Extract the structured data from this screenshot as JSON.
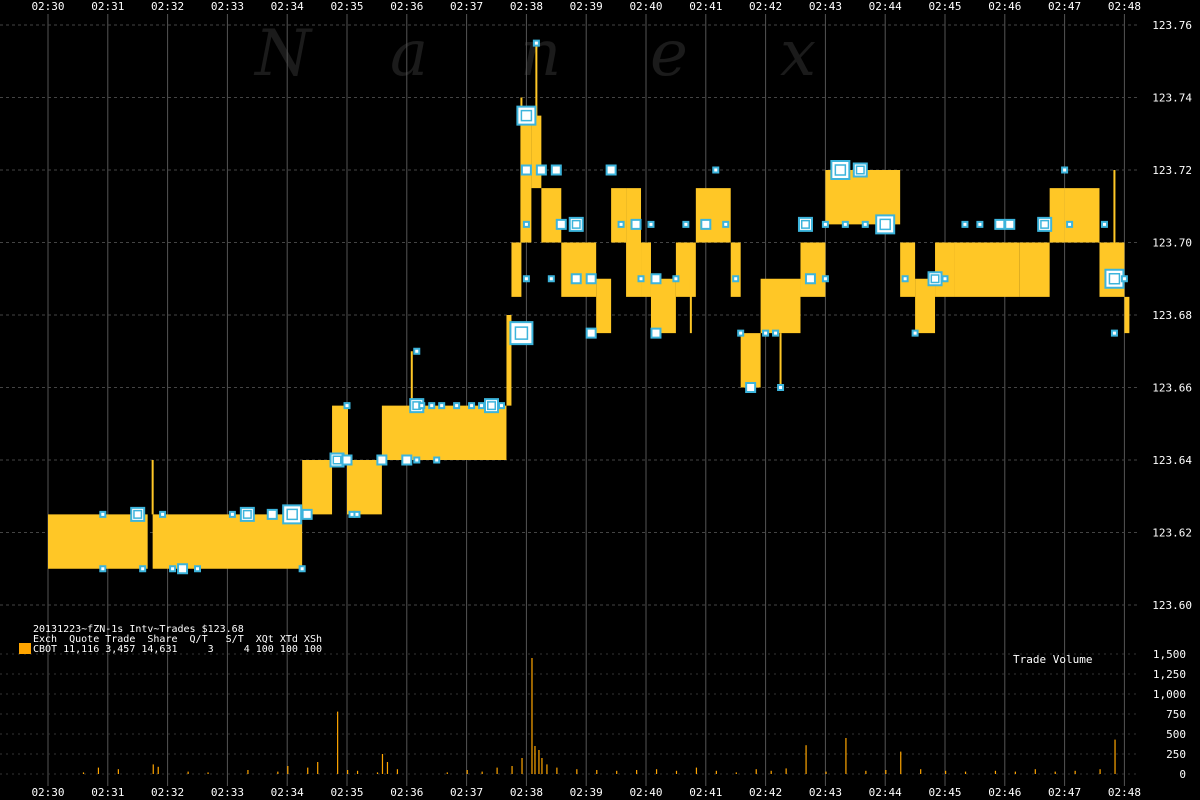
{
  "watermark": [
    "N",
    "a",
    "n",
    "e",
    "x"
  ],
  "info": {
    "title": "20131223~fZN-1s Intv~Trades $123.68",
    "header": "Exch  Quote Trade  Share  Q/T   S/T  XQt XTd XSh",
    "row": "CBOT 11,116 3,457 14,631     3     4 100 100 100",
    "swatch_color": "#FFA500"
  },
  "chart_data": [
    {
      "type": "area",
      "title": "",
      "x_ticks": [
        "02:30",
        "02:31",
        "02:32",
        "02:33",
        "02:34",
        "02:35",
        "02:36",
        "02:37",
        "02:38",
        "02:39",
        "02:40",
        "02:41",
        "02:42",
        "02:43",
        "02:44",
        "02:45",
        "02:46",
        "02:47",
        "02:48"
      ],
      "y_ticks": [
        "123.60",
        "123.62",
        "123.64",
        "123.66",
        "123.68",
        "123.70",
        "123.72",
        "123.74",
        "123.76"
      ],
      "ylim": [
        123.6,
        123.76
      ],
      "grid": true,
      "band_color": "#FFC726",
      "quote_marker_color": "#3CB4DC",
      "bid_ask_band": [
        {
          "t_start": "02:30:00",
          "t_end": "02:31:40",
          "low": 123.61,
          "high": 123.625
        },
        {
          "t_start": "02:31:45",
          "t_end": "02:34:15",
          "low": 123.61,
          "high": 123.625
        },
        {
          "t_start": "02:34:15",
          "t_end": "02:34:45",
          "low": 123.625,
          "high": 123.64
        },
        {
          "t_start": "02:34:45",
          "t_end": "02:35:00",
          "low": 123.64,
          "high": 123.655
        },
        {
          "t_start": "02:35:00",
          "t_end": "02:35:35",
          "low": 123.625,
          "high": 123.64
        },
        {
          "t_start": "02:35:35",
          "t_end": "02:37:40",
          "low": 123.64,
          "high": 123.655
        },
        {
          "t_start": "02:37:40",
          "t_end": "02:37:45",
          "low": 123.655,
          "high": 123.68
        },
        {
          "t_start": "02:37:45",
          "t_end": "02:37:55",
          "low": 123.685,
          "high": 123.7
        },
        {
          "t_start": "02:37:55",
          "t_end": "02:38:05",
          "low": 123.7,
          "high": 123.735
        },
        {
          "t_start": "02:38:05",
          "t_end": "02:38:15",
          "low": 123.715,
          "high": 123.735
        },
        {
          "t_start": "02:38:15",
          "t_end": "02:38:35",
          "low": 123.7,
          "high": 123.715
        },
        {
          "t_start": "02:38:35",
          "t_end": "02:39:10",
          "low": 123.685,
          "high": 123.7
        },
        {
          "t_start": "02:39:10",
          "t_end": "02:39:25",
          "low": 123.675,
          "high": 123.69
        },
        {
          "t_start": "02:39:25",
          "t_end": "02:39:40",
          "low": 123.7,
          "high": 123.715
        },
        {
          "t_start": "02:39:40",
          "t_end": "02:39:55",
          "low": 123.685,
          "high": 123.715
        },
        {
          "t_start": "02:39:55",
          "t_end": "02:40:05",
          "low": 123.685,
          "high": 123.7
        },
        {
          "t_start": "02:40:05",
          "t_end": "02:40:30",
          "low": 123.675,
          "high": 123.69
        },
        {
          "t_start": "02:40:30",
          "t_end": "02:40:50",
          "low": 123.685,
          "high": 123.7
        },
        {
          "t_start": "02:40:50",
          "t_end": "02:41:25",
          "low": 123.7,
          "high": 123.715
        },
        {
          "t_start": "02:41:25",
          "t_end": "02:41:35",
          "low": 123.685,
          "high": 123.7
        },
        {
          "t_start": "02:41:35",
          "t_end": "02:41:55",
          "low": 123.66,
          "high": 123.675
        },
        {
          "t_start": "02:41:55",
          "t_end": "02:42:35",
          "low": 123.675,
          "high": 123.69
        },
        {
          "t_start": "02:42:35",
          "t_end": "02:43:00",
          "low": 123.685,
          "high": 123.7
        },
        {
          "t_start": "02:43:00",
          "t_end": "02:44:15",
          "low": 123.705,
          "high": 123.72
        },
        {
          "t_start": "02:44:15",
          "t_end": "02:44:30",
          "low": 123.685,
          "high": 123.7
        },
        {
          "t_start": "02:44:30",
          "t_end": "02:44:50",
          "low": 123.675,
          "high": 123.69
        },
        {
          "t_start": "02:44:50",
          "t_end": "02:45:10",
          "low": 123.685,
          "high": 123.7
        },
        {
          "t_start": "02:45:10",
          "t_end": "02:46:15",
          "low": 123.685,
          "high": 123.7
        },
        {
          "t_start": "02:46:15",
          "t_end": "02:46:45",
          "low": 123.685,
          "high": 123.7
        },
        {
          "t_start": "02:46:45",
          "t_end": "02:47:00",
          "low": 123.7,
          "high": 123.715
        },
        {
          "t_start": "02:47:00",
          "t_end": "02:47:35",
          "low": 123.7,
          "high": 123.715
        },
        {
          "t_start": "02:47:35",
          "t_end": "02:48:00",
          "low": 123.685,
          "high": 123.7
        },
        {
          "t_start": "02:48:00",
          "t_end": "02:48:05",
          "low": 123.675,
          "high": 123.685
        }
      ],
      "spikes": [
        {
          "t": "02:31:45",
          "low": 123.625,
          "high": 123.64
        },
        {
          "t": "02:35:00",
          "low": 123.64,
          "high": 123.655
        },
        {
          "t": "02:36:05",
          "low": 123.655,
          "high": 123.67
        },
        {
          "t": "02:37:55",
          "low": 123.7,
          "high": 123.74
        },
        {
          "t": "02:38:10",
          "low": 123.72,
          "high": 123.755
        },
        {
          "t": "02:40:45",
          "low": 123.675,
          "high": 123.69
        },
        {
          "t": "02:42:15",
          "low": 123.66,
          "high": 123.675
        },
        {
          "t": "02:47:50",
          "low": 123.7,
          "high": 123.72
        }
      ],
      "trade_markers": [
        {
          "t": "02:30:55",
          "price": 123.625,
          "size": 1
        },
        {
          "t": "02:30:55",
          "price": 123.61,
          "size": 1
        },
        {
          "t": "02:31:30",
          "price": 123.625,
          "size": 2
        },
        {
          "t": "02:31:30",
          "price": 123.625,
          "size": 3
        },
        {
          "t": "02:31:35",
          "price": 123.61,
          "size": 1
        },
        {
          "t": "02:31:55",
          "price": 123.625,
          "size": 1
        },
        {
          "t": "02:32:05",
          "price": 123.61,
          "size": 1
        },
        {
          "t": "02:32:15",
          "price": 123.61,
          "size": 2
        },
        {
          "t": "02:32:30",
          "price": 123.61,
          "size": 1
        },
        {
          "t": "02:33:05",
          "price": 123.625,
          "size": 1
        },
        {
          "t": "02:33:20",
          "price": 123.625,
          "size": 3
        },
        {
          "t": "02:33:45",
          "price": 123.625,
          "size": 2
        },
        {
          "t": "02:34:05",
          "price": 123.625,
          "size": 4
        },
        {
          "t": "02:34:15",
          "price": 123.61,
          "size": 1
        },
        {
          "t": "02:34:20",
          "price": 123.625,
          "size": 2
        },
        {
          "t": "02:34:50",
          "price": 123.64,
          "size": 3
        },
        {
          "t": "02:35:00",
          "price": 123.655,
          "size": 1
        },
        {
          "t": "02:35:00",
          "price": 123.64,
          "size": 2
        },
        {
          "t": "02:35:35",
          "price": 123.64,
          "size": 2
        },
        {
          "t": "02:35:05",
          "price": 123.625,
          "size": 1
        },
        {
          "t": "02:35:10",
          "price": 123.625,
          "size": 1
        },
        {
          "t": "02:36:10",
          "price": 123.655,
          "size": 3
        },
        {
          "t": "02:36:10",
          "price": 123.67,
          "size": 1
        },
        {
          "t": "02:36:15",
          "price": 123.655,
          "size": 1
        },
        {
          "t": "02:36:25",
          "price": 123.655,
          "size": 1
        },
        {
          "t": "02:36:35",
          "price": 123.655,
          "size": 1
        },
        {
          "t": "02:36:50",
          "price": 123.655,
          "size": 1
        },
        {
          "t": "02:37:05",
          "price": 123.655,
          "size": 1
        },
        {
          "t": "02:37:15",
          "price": 123.655,
          "size": 1
        },
        {
          "t": "02:37:25",
          "price": 123.655,
          "size": 3
        },
        {
          "t": "02:37:35",
          "price": 123.655,
          "size": 1
        },
        {
          "t": "02:36:00",
          "price": 123.64,
          "size": 2
        },
        {
          "t": "02:36:10",
          "price": 123.64,
          "size": 1
        },
        {
          "t": "02:36:30",
          "price": 123.64,
          "size": 1
        },
        {
          "t": "02:37:55",
          "price": 123.675,
          "size": 5
        },
        {
          "t": "02:38:00",
          "price": 123.69,
          "size": 1
        },
        {
          "t": "02:38:00",
          "price": 123.735,
          "size": 4
        },
        {
          "t": "02:38:10",
          "price": 123.755,
          "size": 1
        },
        {
          "t": "02:38:00",
          "price": 123.72,
          "size": 2
        },
        {
          "t": "02:38:15",
          "price": 123.72,
          "size": 2
        },
        {
          "t": "02:38:30",
          "price": 123.72,
          "size": 2
        },
        {
          "t": "02:38:00",
          "price": 123.705,
          "size": 1
        },
        {
          "t": "02:38:35",
          "price": 123.705,
          "size": 2
        },
        {
          "t": "02:38:50",
          "price": 123.705,
          "size": 3
        },
        {
          "t": "02:38:25",
          "price": 123.69,
          "size": 1
        },
        {
          "t": "02:38:50",
          "price": 123.69,
          "size": 2
        },
        {
          "t": "02:39:05",
          "price": 123.69,
          "size": 2
        },
        {
          "t": "02:39:35",
          "price": 123.705,
          "size": 1
        },
        {
          "t": "02:39:25",
          "price": 123.72,
          "size": 2
        },
        {
          "t": "02:39:50",
          "price": 123.705,
          "size": 2
        },
        {
          "t": "02:39:55",
          "price": 123.69,
          "size": 1
        },
        {
          "t": "02:39:05",
          "price": 123.675,
          "size": 2
        },
        {
          "t": "02:40:10",
          "price": 123.675,
          "size": 2
        },
        {
          "t": "02:40:05",
          "price": 123.705,
          "size": 1
        },
        {
          "t": "02:40:10",
          "price": 123.69,
          "size": 2
        },
        {
          "t": "02:40:30",
          "price": 123.69,
          "size": 1
        },
        {
          "t": "02:40:40",
          "price": 123.705,
          "size": 1
        },
        {
          "t": "02:41:00",
          "price": 123.705,
          "size": 2
        },
        {
          "t": "02:41:10",
          "price": 123.72,
          "size": 1
        },
        {
          "t": "02:41:20",
          "price": 123.705,
          "size": 1
        },
        {
          "t": "02:41:30",
          "price": 123.69,
          "size": 1
        },
        {
          "t": "02:41:35",
          "price": 123.675,
          "size": 1
        },
        {
          "t": "02:41:45",
          "price": 123.66,
          "size": 2
        },
        {
          "t": "02:42:00",
          "price": 123.675,
          "size": 1
        },
        {
          "t": "02:42:10",
          "price": 123.675,
          "size": 1
        },
        {
          "t": "02:42:15",
          "price": 123.66,
          "size": 1
        },
        {
          "t": "02:42:40",
          "price": 123.705,
          "size": 3
        },
        {
          "t": "02:42:45",
          "price": 123.69,
          "size": 2
        },
        {
          "t": "02:43:00",
          "price": 123.69,
          "size": 1
        },
        {
          "t": "02:43:00",
          "price": 123.705,
          "size": 1
        },
        {
          "t": "02:43:15",
          "price": 123.72,
          "size": 4
        },
        {
          "t": "02:43:35",
          "price": 123.72,
          "size": 3
        },
        {
          "t": "02:43:20",
          "price": 123.705,
          "size": 1
        },
        {
          "t": "02:43:40",
          "price": 123.705,
          "size": 1
        },
        {
          "t": "02:44:00",
          "price": 123.705,
          "size": 4
        },
        {
          "t": "02:44:20",
          "price": 123.69,
          "size": 1
        },
        {
          "t": "02:44:30",
          "price": 123.675,
          "size": 1
        },
        {
          "t": "02:44:50",
          "price": 123.69,
          "size": 3
        },
        {
          "t": "02:45:00",
          "price": 123.69,
          "size": 1
        },
        {
          "t": "02:45:20",
          "price": 123.705,
          "size": 1
        },
        {
          "t": "02:45:35",
          "price": 123.705,
          "size": 1
        },
        {
          "t": "02:45:55",
          "price": 123.705,
          "size": 2
        },
        {
          "t": "02:46:05",
          "price": 123.705,
          "size": 2
        },
        {
          "t": "02:46:40",
          "price": 123.705,
          "size": 3
        },
        {
          "t": "02:47:00",
          "price": 123.72,
          "size": 1
        },
        {
          "t": "02:47:05",
          "price": 123.705,
          "size": 1
        },
        {
          "t": "02:47:40",
          "price": 123.705,
          "size": 1
        },
        {
          "t": "02:47:50",
          "price": 123.69,
          "size": 4
        },
        {
          "t": "02:48:00",
          "price": 123.69,
          "size": 1
        },
        {
          "t": "02:47:50",
          "price": 123.675,
          "size": 1
        }
      ]
    },
    {
      "type": "bar",
      "title": "Trade Volume",
      "y_ticks": [
        "0",
        "250",
        "500",
        "750",
        "1,000",
        "1,250",
        "1,500"
      ],
      "ylim": [
        0,
        1500
      ],
      "color": "#FFA500",
      "bars": [
        {
          "t": "02:30:35",
          "v": 20
        },
        {
          "t": "02:30:50",
          "v": 80
        },
        {
          "t": "02:31:10",
          "v": 60
        },
        {
          "t": "02:31:45",
          "v": 120
        },
        {
          "t": "02:31:50",
          "v": 90
        },
        {
          "t": "02:32:20",
          "v": 30
        },
        {
          "t": "02:32:40",
          "v": 20
        },
        {
          "t": "02:33:20",
          "v": 50
        },
        {
          "t": "02:33:50",
          "v": 30
        },
        {
          "t": "02:34:00",
          "v": 100
        },
        {
          "t": "02:34:20",
          "v": 80
        },
        {
          "t": "02:34:30",
          "v": 150
        },
        {
          "t": "02:34:50",
          "v": 780
        },
        {
          "t": "02:35:00",
          "v": 50
        },
        {
          "t": "02:35:10",
          "v": 40
        },
        {
          "t": "02:35:30",
          "v": 20
        },
        {
          "t": "02:35:35",
          "v": 250
        },
        {
          "t": "02:35:40",
          "v": 150
        },
        {
          "t": "02:35:50",
          "v": 60
        },
        {
          "t": "02:36:40",
          "v": 20
        },
        {
          "t": "02:37:00",
          "v": 50
        },
        {
          "t": "02:37:15",
          "v": 30
        },
        {
          "t": "02:37:30",
          "v": 80
        },
        {
          "t": "02:37:45",
          "v": 100
        },
        {
          "t": "02:37:55",
          "v": 200
        },
        {
          "t": "02:38:05",
          "v": 1450
        },
        {
          "t": "02:38:08",
          "v": 350
        },
        {
          "t": "02:38:12",
          "v": 300
        },
        {
          "t": "02:38:15",
          "v": 200
        },
        {
          "t": "02:38:20",
          "v": 120
        },
        {
          "t": "02:38:30",
          "v": 80
        },
        {
          "t": "02:38:50",
          "v": 60
        },
        {
          "t": "02:39:10",
          "v": 50
        },
        {
          "t": "02:39:30",
          "v": 40
        },
        {
          "t": "02:39:50",
          "v": 50
        },
        {
          "t": "02:40:10",
          "v": 60
        },
        {
          "t": "02:40:30",
          "v": 40
        },
        {
          "t": "02:40:50",
          "v": 80
        },
        {
          "t": "02:41:10",
          "v": 40
        },
        {
          "t": "02:41:30",
          "v": 20
        },
        {
          "t": "02:41:50",
          "v": 60
        },
        {
          "t": "02:42:05",
          "v": 40
        },
        {
          "t": "02:42:20",
          "v": 70
        },
        {
          "t": "02:42:40",
          "v": 360
        },
        {
          "t": "02:43:00",
          "v": 30
        },
        {
          "t": "02:43:20",
          "v": 450
        },
        {
          "t": "02:43:40",
          "v": 40
        },
        {
          "t": "02:44:00",
          "v": 50
        },
        {
          "t": "02:44:15",
          "v": 280
        },
        {
          "t": "02:44:35",
          "v": 60
        },
        {
          "t": "02:45:00",
          "v": 40
        },
        {
          "t": "02:45:20",
          "v": 30
        },
        {
          "t": "02:45:50",
          "v": 40
        },
        {
          "t": "02:46:10",
          "v": 30
        },
        {
          "t": "02:46:30",
          "v": 60
        },
        {
          "t": "02:46:50",
          "v": 30
        },
        {
          "t": "02:47:10",
          "v": 40
        },
        {
          "t": "02:47:35",
          "v": 60
        },
        {
          "t": "02:47:50",
          "v": 430
        }
      ]
    }
  ]
}
